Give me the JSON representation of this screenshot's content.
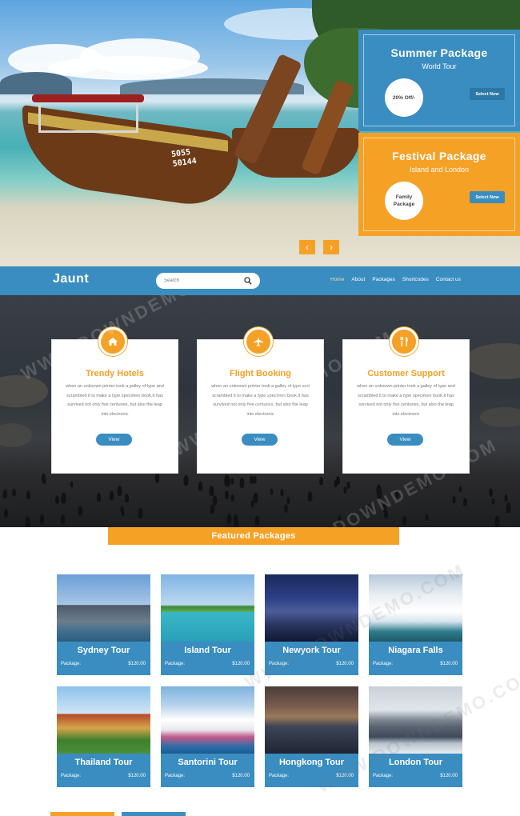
{
  "hero": {
    "boat_text": "5055\n50144",
    "packages": [
      {
        "title": "Summer Package",
        "subtitle": "World Tour",
        "badge": "20% Off/-",
        "button": "Select Now"
      },
      {
        "title": "Festival Package",
        "subtitle": "Island and London",
        "badge": "Family Package",
        "button": "Select Now"
      }
    ],
    "prev_glyph": "‹",
    "next_glyph": "›"
  },
  "nav": {
    "logo": "Jaunt",
    "search_placeholder": "Search",
    "items": [
      "Home",
      "About",
      "Packages",
      "Shortcodes",
      "Contact us"
    ],
    "active": "Home"
  },
  "services": [
    {
      "icon": "home-icon",
      "title": "Trendy Hotels",
      "text": "when an unknown printer took a galley of type and scrambled it to make a type specimen book.It has survived not only five centuries, but also the leap into electronic",
      "button": "View"
    },
    {
      "icon": "airplane-icon",
      "title": "Flight Booking",
      "text": "when an unknown printer took a galley of type and scrambled it to make a type specimen book.It has survived not only five centuries, but also the leap into electronic",
      "button": "View"
    },
    {
      "icon": "utensils-icon",
      "title": "Customer Support",
      "text": "when an unknown printer took a galley of type and scrambled it to make a type specimen book.It has survived not only five centuries, but also the leap into electronic",
      "button": "View"
    }
  ],
  "featured": {
    "heading": "Featured Packages",
    "tours": [
      {
        "name": "Sydney Tour",
        "label": "Package:",
        "price": "$120.00"
      },
      {
        "name": "Island Tour",
        "label": "Package:",
        "price": "$120.00"
      },
      {
        "name": "Newyork Tour",
        "label": "Package:",
        "price": "$120.00"
      },
      {
        "name": "Niagara Falls",
        "label": "Package:",
        "price": "$120.00"
      },
      {
        "name": "Thailand Tour",
        "label": "Package:",
        "price": "$120.00"
      },
      {
        "name": "Santorini Tour",
        "label": "Package:",
        "price": "$120.00"
      },
      {
        "name": "Hongkong Tour",
        "label": "Package:",
        "price": "$120.00"
      },
      {
        "name": "London Tour",
        "label": "Package:",
        "price": "$120.00"
      }
    ]
  },
  "watermark": "WWW.DOWNDEMO.COM",
  "colors": {
    "primary_blue": "#3a8dc0",
    "accent_orange": "#f4a126"
  }
}
